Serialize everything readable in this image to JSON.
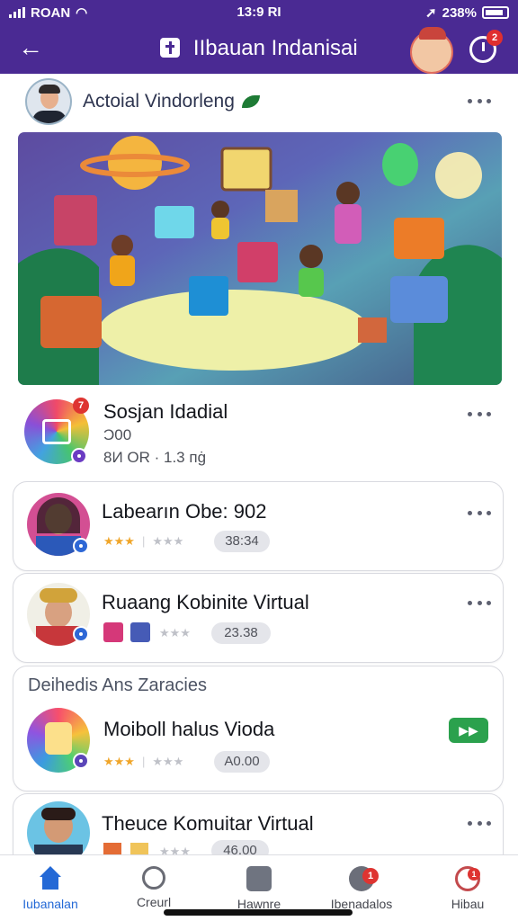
{
  "status_bar": {
    "carrier": "ROAN",
    "time": "13:9 RI",
    "battery": "238%"
  },
  "header": {
    "title": "IIbauan Indanisai",
    "timer_badge": "2"
  },
  "post": {
    "author": "Actoial Vindorleng"
  },
  "items": [
    {
      "title": "Sosjan Idadial",
      "line1": "Ɔ00",
      "line2": "8И ОR · 1.3 пġ",
      "badge": "7"
    },
    {
      "title": "Labearın Obe: 902",
      "pill": "38:34"
    },
    {
      "title": "Ruaang Kobinite Virtual",
      "pill": "23.38"
    },
    {
      "title": "Moiboll halus Vioda",
      "pill": "A0.00"
    },
    {
      "title": "Theuce Komuitar Virtual",
      "pill": "46.00"
    }
  ],
  "section": {
    "title": "Deihedis Ans Zaracies"
  },
  "tabs": [
    {
      "label": "Iubanalan"
    },
    {
      "label": "Creurl"
    },
    {
      "label": "Hawnre"
    },
    {
      "label": "Ibenadalos"
    },
    {
      "label": "Hibau"
    }
  ],
  "tab_badges": [
    "1",
    "1"
  ],
  "colors": {
    "brand": "#4a2a93",
    "accent": "#2469d6",
    "go": "#2ba14d",
    "badge": "#de3431"
  }
}
